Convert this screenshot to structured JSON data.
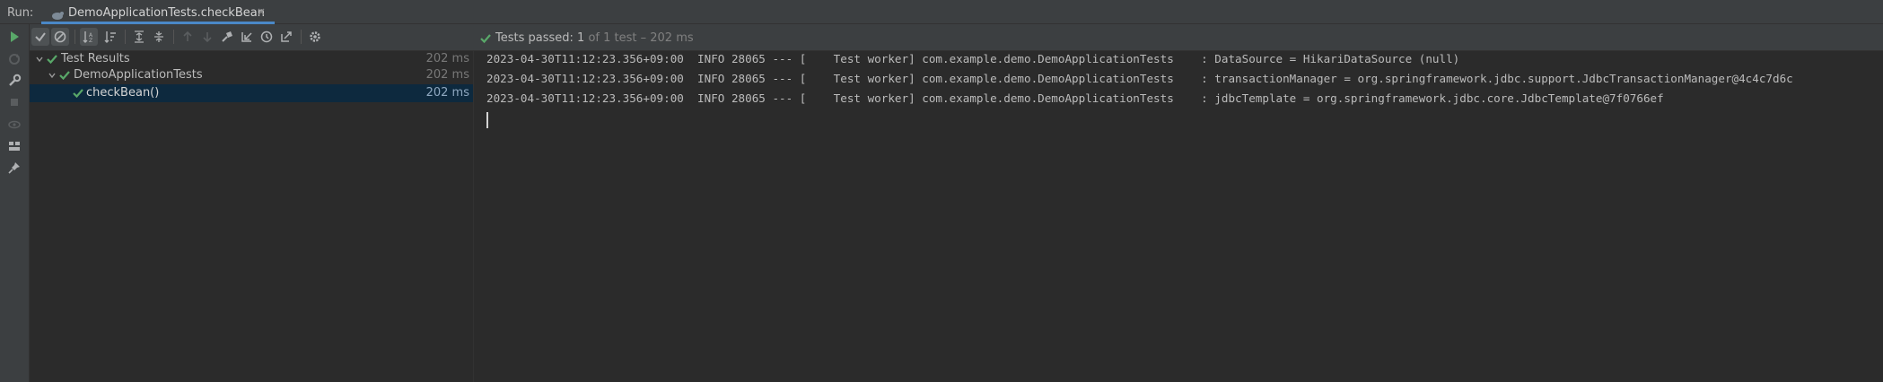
{
  "run": {
    "label": "Run:",
    "tab_title": "DemoApplicationTests.checkBean",
    "tab_close": "×"
  },
  "toolbar": {
    "buttons": [
      "show-passed-icon",
      "show-ignored-icon",
      "sort-alpha-icon",
      "sort-duration-icon",
      "expand-all-icon",
      "collapse-all-icon",
      "prev-failed-icon",
      "next-failed-icon",
      "rerun-icon",
      "import-tests-icon",
      "history-icon",
      "export-icon",
      "settings-icon"
    ]
  },
  "status": {
    "prefix": "Tests passed: ",
    "count": "1",
    "suffix": " of 1 test – 202 ms"
  },
  "leftbar": {
    "icons": [
      "run-icon",
      "rerun-failed-icon",
      "wrench-icon",
      "stop-icon",
      "eye-icon",
      "layout-icon",
      "pin-icon"
    ]
  },
  "tree": {
    "rows": [
      {
        "label": "Test Results",
        "duration": "202 ms"
      },
      {
        "label": "DemoApplicationTests",
        "duration": "202 ms"
      },
      {
        "label": "checkBean()",
        "duration": "202 ms"
      }
    ]
  },
  "console": {
    "lines": [
      "2023-04-30T11:12:23.356+09:00  INFO 28065 --- [    Test worker] com.example.demo.DemoApplicationTests    : DataSource = HikariDataSource (null)",
      "2023-04-30T11:12:23.356+09:00  INFO 28065 --- [    Test worker] com.example.demo.DemoApplicationTests    : transactionManager = org.springframework.jdbc.support.JdbcTransactionManager@4c4c7d6c",
      "2023-04-30T11:12:23.356+09:00  INFO 28065 --- [    Test worker] com.example.demo.DemoApplicationTests    : jdbcTemplate = org.springframework.jdbc.core.JdbcTemplate@7f0766ef"
    ]
  },
  "colors": {
    "background": "#2b2b2b",
    "panel": "#3c3f41",
    "pass_green": "#59a869",
    "selection": "#0d293e",
    "tab_underline": "#4a88c7"
  }
}
